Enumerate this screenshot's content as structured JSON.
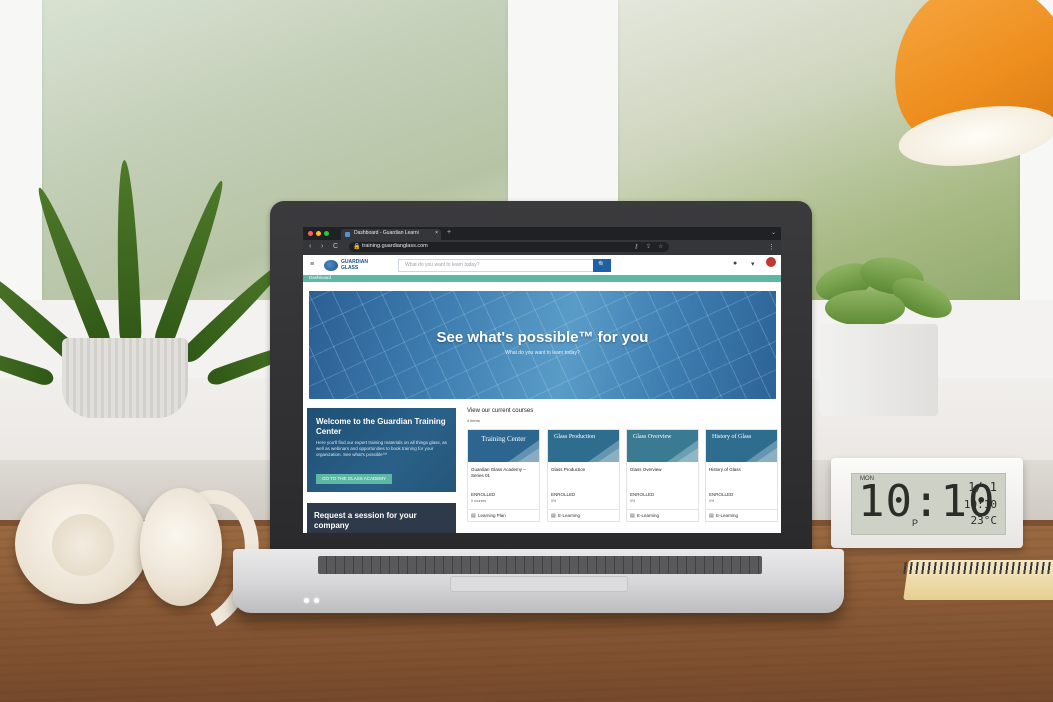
{
  "browser": {
    "tab_title": "Dashboard - Guardian Learni",
    "tab_close": "×",
    "new_tab": "+",
    "url": "training.guardianglass.com",
    "nav_back": "‹",
    "nav_forward": "›",
    "nav_reload": "C",
    "lock_icon": "lock-icon",
    "menu": "⋮"
  },
  "site": {
    "logo_text": "GUARDIAN GLASS",
    "search_placeholder": "What do you want to learn today?",
    "search_button": "🔍",
    "breadcrumb": "Dashboard"
  },
  "hero": {
    "title": "See what's possible™ for you",
    "subtitle": "What do you want to learn today?"
  },
  "welcome": {
    "title": "Welcome to the Guardian Training Center",
    "body": "Here you'll find our expert training materials on all things glass, as well as webinars and opportunities to book training for your organization. See what's possible™",
    "button": "GO TO THE GLASS ACADEMY"
  },
  "request": {
    "title": "Request a session for your company"
  },
  "courses": {
    "title": "View our current courses",
    "subtitle": "4 items",
    "items": [
      {
        "image_title": "Training Center",
        "name": "Guardian Glass Academy – Series 01",
        "status": "ENROLLED",
        "substatus": "0 courses",
        "type": "Learning Plan",
        "bg": "#2c6690"
      },
      {
        "image_title": "Glass Production",
        "name": "Glass Production",
        "status": "ENROLLED",
        "substatus": "0%",
        "type": "E-Learning",
        "bg": "#2f6d8e"
      },
      {
        "image_title": "Glass Overview",
        "name": "Glass Overview",
        "status": "ENROLLED",
        "substatus": "0%",
        "type": "E-Learning",
        "bg": "#3a7b93"
      },
      {
        "image_title": "History of Glass",
        "name": "History of Glass",
        "status": "ENROLLED",
        "substatus": "0%",
        "type": "E-Learning",
        "bg": "#2f6d8e"
      }
    ]
  },
  "clock": {
    "day": "MON",
    "time": "10:10",
    "period": "P",
    "date": "1/ 1",
    "seconds": "10:10",
    "temperature": "23°C"
  },
  "colors": {
    "teal": "#5cb7a5",
    "navy": "#1f4f74",
    "dark": "#2e3a49",
    "brand_blue": "#1d5fa8"
  }
}
